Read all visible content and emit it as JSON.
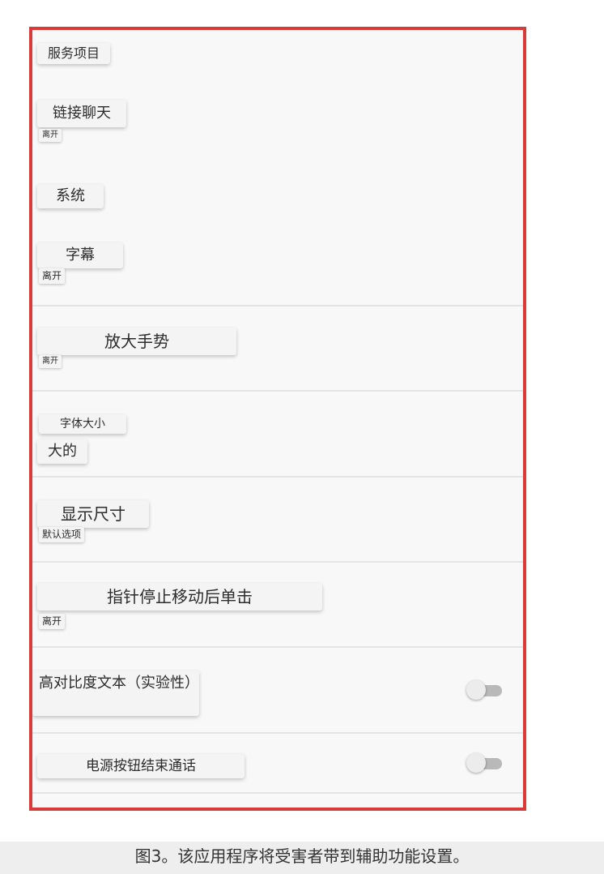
{
  "settings": {
    "section_header": "服务项目",
    "items": [
      {
        "title": "链接聊天",
        "subtitle": "离开"
      },
      {
        "title": "系统"
      },
      {
        "title": "字幕",
        "subtitle": "离开"
      },
      {
        "title": "放大手势",
        "subtitle": "离开"
      },
      {
        "title": "字体大小",
        "subtitle": "大的"
      },
      {
        "title": "显示尺寸",
        "subtitle": "默认选项"
      },
      {
        "title": "指针停止移动后单击",
        "subtitle": "离开"
      },
      {
        "title": "高对比度文本（实验性）",
        "toggle": "off"
      },
      {
        "title": "电源按钮结束通话",
        "toggle": "off"
      }
    ]
  },
  "highlight_color": "#d93a3a",
  "caption": "图3。该应用程序将受害者带到辅助功能设置。"
}
